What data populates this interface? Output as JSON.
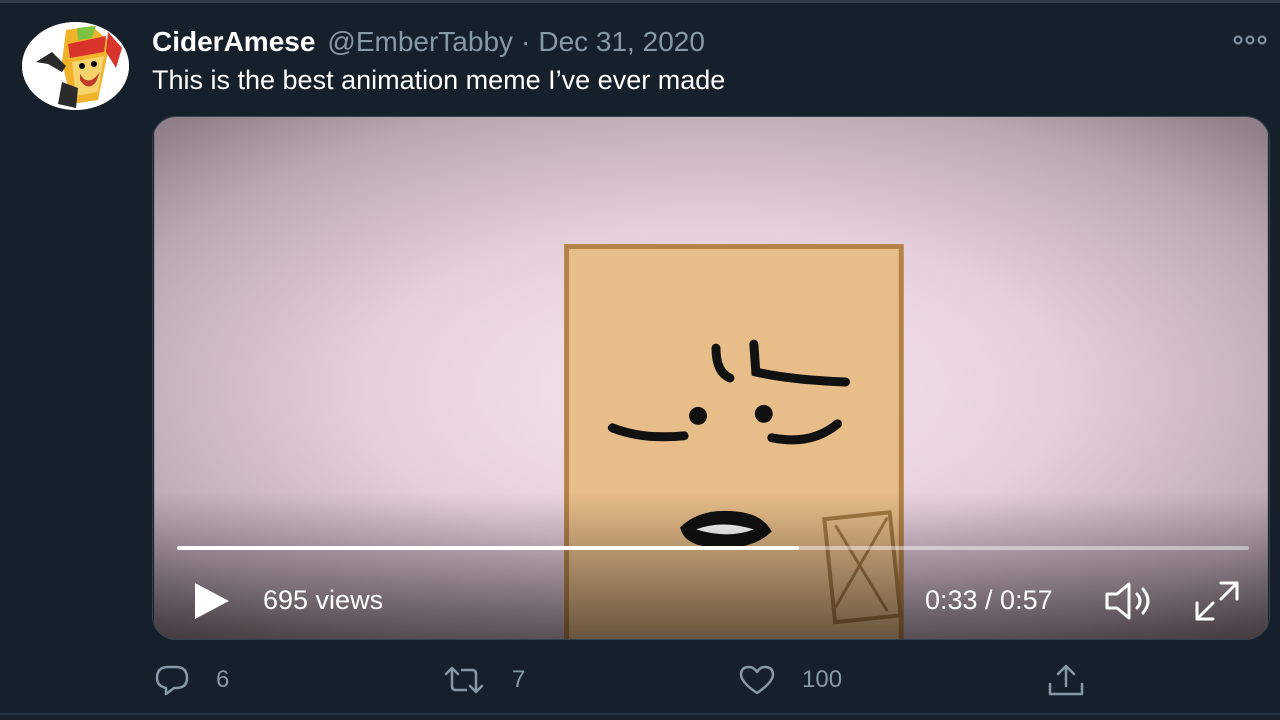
{
  "tweet": {
    "display_name": "CiderAmese",
    "handle": "@EmberTabby",
    "separator": "·",
    "date": "Dec 31, 2020",
    "text": "This is the best animation meme I’ve ever made"
  },
  "video": {
    "views": "695 views",
    "time": "0:33 / 0:57",
    "progress_fraction": 0.58
  },
  "actions": {
    "reply_count": "6",
    "retweet_count": "7",
    "like_count": "100"
  },
  "icons": [
    "avatar",
    "more-icon",
    "play-icon",
    "volume-icon",
    "fullscreen-icon",
    "reply-icon",
    "retweet-icon",
    "like-icon",
    "share-icon"
  ],
  "colors": {
    "background": "#15202b",
    "secondary_text": "#8899a6",
    "primary_text": "#ffffff"
  }
}
